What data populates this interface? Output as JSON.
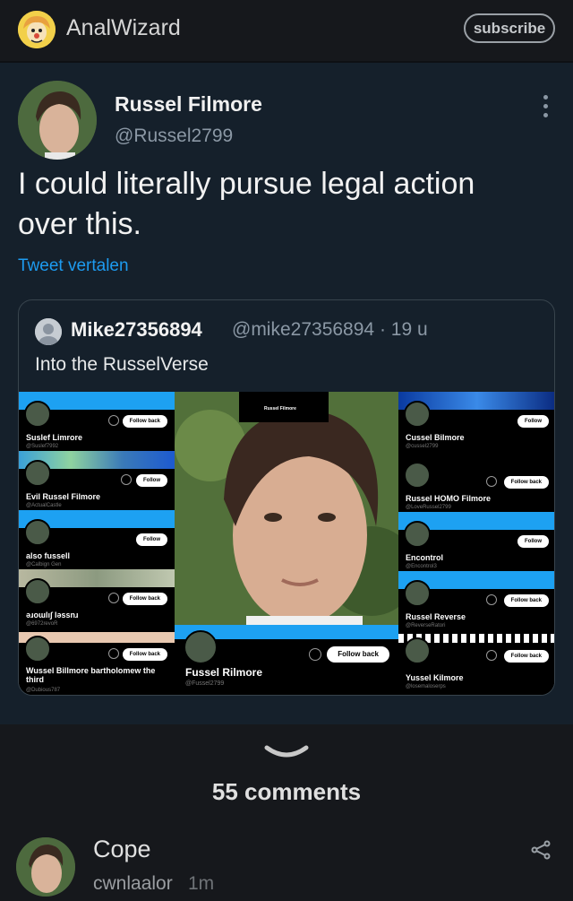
{
  "header": {
    "channel_name": "AnalWizard",
    "subscribe_label": "subscribe"
  },
  "tweet": {
    "author_name": "Russel Filmore",
    "author_handle": "@Russel2799",
    "text": "I could literally pursue legal action over this.",
    "translate_label": "Tweet vertalen"
  },
  "quote": {
    "author_name": "Mike27356894",
    "author_handle": "@mike27356894",
    "time": "· 19 u",
    "text": "Into the RusselVerse",
    "cards": [
      {
        "name": "Suslef Limrore",
        "handle": "@Suslef7992",
        "button": "Follow back"
      },
      {
        "name": "Evil Russel Filmore",
        "handle": "@ActualCastle",
        "button": "Follow"
      },
      {
        "name": "also fussell",
        "handle": "@Calbign Gen",
        "button": "Follow"
      },
      {
        "name": "ǝɹoɯlı∫ lǝssnɹ",
        "handle": "@6972revoR",
        "button": "Follow back"
      },
      {
        "name": "Wussel Billmore bartholomew the third",
        "handle": "@Dubious787",
        "button": "Follow back"
      },
      {
        "name": "Cussel Bilmore",
        "handle": "@cussel2799",
        "button": "Follow"
      },
      {
        "name": "Russel HOMO Filmore",
        "handle": "@LoveRussel2799",
        "button": "Follow back"
      },
      {
        "name": "Encontrol",
        "handle": "@Encontrol3",
        "button": "Follow"
      },
      {
        "name": "Russel Reverse",
        "handle": "@ReverseRatori",
        "button": "Follow back"
      },
      {
        "name": "Yussel Kilmore",
        "handle": "@losemaloserps",
        "button": "Follow back"
      },
      {
        "name": "Fussel Rilmore",
        "handle": "@Fussel2799",
        "button": "Follow back"
      },
      {
        "name": "Russel Filmore",
        "handle": "",
        "button": ""
      }
    ]
  },
  "comments": {
    "count_label": "55 comments",
    "first": {
      "text": "Cope",
      "user": "cwnlaalor",
      "time": "1m"
    }
  }
}
